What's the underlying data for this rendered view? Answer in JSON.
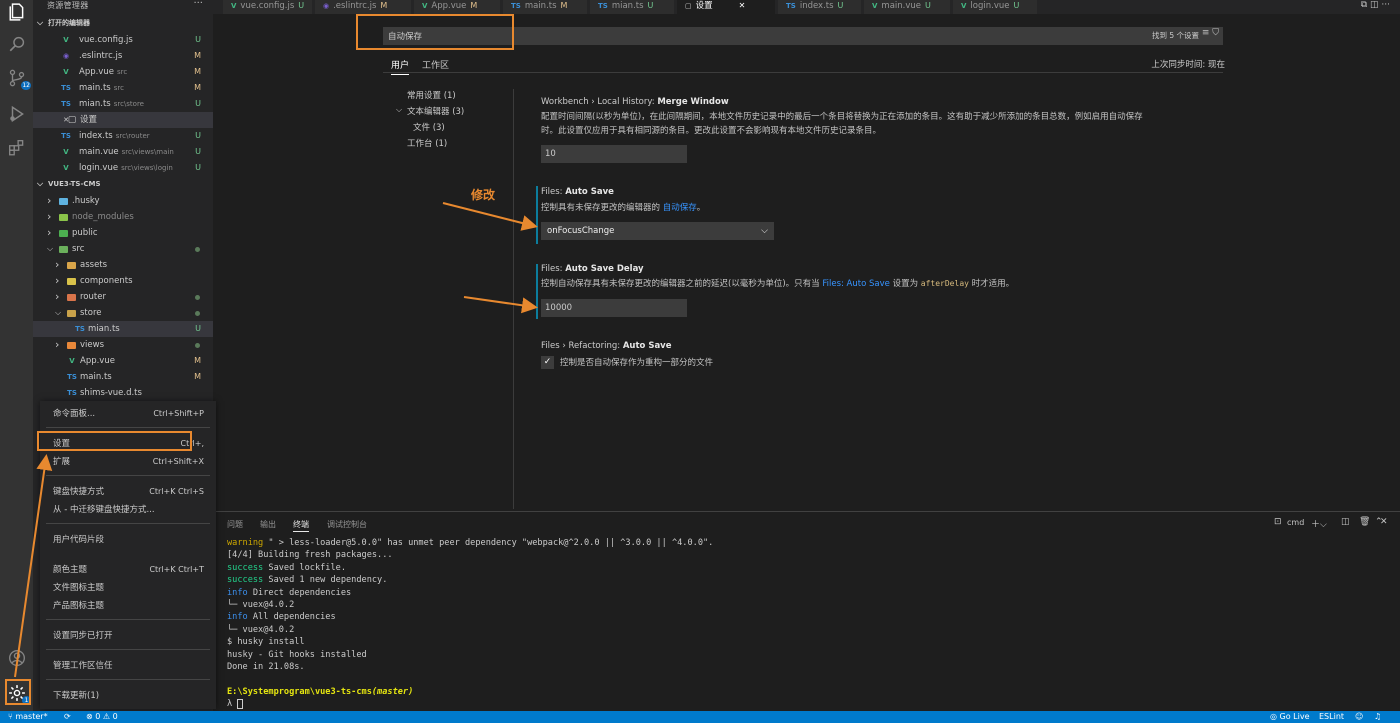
{
  "sidebar": {
    "title": "资源管理器",
    "open_editors_header": "打开的编辑器",
    "open_editors": [
      {
        "icon": "V",
        "name": "vue.config.js",
        "path": "",
        "status": "U"
      },
      {
        "icon": "◉",
        "name": ".eslintrc.js",
        "path": "",
        "status": "M"
      },
      {
        "icon": "V",
        "name": "App.vue",
        "path": "src",
        "status": "M"
      },
      {
        "icon": "TS",
        "name": "main.ts",
        "path": "src",
        "status": "M"
      },
      {
        "icon": "TS",
        "name": "mian.ts",
        "path": "src\\store",
        "status": "U"
      },
      {
        "icon": "✕",
        "name": "设置",
        "path": "",
        "status": ""
      },
      {
        "icon": "TS",
        "name": "index.ts",
        "path": "src\\router",
        "status": "U"
      },
      {
        "icon": "V",
        "name": "main.vue",
        "path": "src\\views\\main",
        "status": "U"
      },
      {
        "icon": "V",
        "name": "login.vue",
        "path": "src\\views\\login",
        "status": "U"
      }
    ],
    "project_header": "VUE3-TS-CMS",
    "tree": [
      {
        "name": ".husky",
        "status": ""
      },
      {
        "name": "node_modules",
        "status": ""
      },
      {
        "name": "public",
        "status": ""
      },
      {
        "name": "src",
        "status": "•"
      },
      {
        "name": "assets",
        "status": ""
      },
      {
        "name": "components",
        "status": ""
      },
      {
        "name": "router",
        "status": "•"
      },
      {
        "name": "store",
        "status": "•"
      },
      {
        "name": "mian.ts",
        "status": "U"
      },
      {
        "name": "views",
        "status": "•"
      },
      {
        "name": "App.vue",
        "status": "M"
      },
      {
        "name": "main.ts",
        "status": "M"
      },
      {
        "name": "shims-vue.d.ts",
        "status": ""
      }
    ]
  },
  "activity": {
    "scm_badge": "12",
    "manage_badge": "1"
  },
  "menu": {
    "items": [
      {
        "label": "命令面板...",
        "key": "Ctrl+Shift+P"
      },
      {
        "label": "设置",
        "key": "Ctrl+,"
      },
      {
        "label": "扩展",
        "key": "Ctrl+Shift+X"
      },
      {
        "label": "键盘快捷方式",
        "key": "Ctrl+K Ctrl+S"
      },
      {
        "label": "从 - 中迁移键盘快捷方式...",
        "key": ""
      },
      {
        "label": "用户代码片段",
        "key": ""
      },
      {
        "label": "颜色主题",
        "key": "Ctrl+K Ctrl+T"
      },
      {
        "label": "文件图标主题",
        "key": ""
      },
      {
        "label": "产品图标主题",
        "key": ""
      },
      {
        "label": "设置同步已打开",
        "key": ""
      },
      {
        "label": "管理工作区信任",
        "key": ""
      },
      {
        "label": "下载更新(1)",
        "key": ""
      }
    ]
  },
  "tabs": [
    {
      "icon": "V",
      "label": "vue.config.js",
      "status": "U",
      "active": false
    },
    {
      "icon": "◉",
      "label": ".eslintrc.js",
      "status": "M",
      "active": false
    },
    {
      "icon": "V",
      "label": "App.vue",
      "status": "M",
      "active": false
    },
    {
      "icon": "TS",
      "label": "main.ts",
      "status": "M",
      "active": false
    },
    {
      "icon": "TS",
      "label": "mian.ts",
      "status": "U",
      "active": false
    },
    {
      "icon": "▢",
      "label": "设置",
      "status": "✕",
      "active": true
    },
    {
      "icon": "TS",
      "label": "index.ts",
      "status": "U",
      "active": false
    },
    {
      "icon": "V",
      "label": "main.vue",
      "status": "U",
      "active": false
    },
    {
      "icon": "V",
      "label": "login.vue",
      "status": "U",
      "active": false
    }
  ],
  "settings": {
    "search_value": "自动保存",
    "found_text": "找到 5 个设置",
    "scope_tabs": [
      "用户",
      "工作区"
    ],
    "sync_text": "上次同步时间: 现在",
    "toc": [
      "常用设置 (1)",
      "文本编辑器 (3)",
      "文件 (3)",
      "工作台 (1)"
    ],
    "items": [
      {
        "category": "Workbench › Local History: ",
        "name": "Merge Window",
        "desc_1": "配置时间间隔(以秒为单位)，在此间隔期间，本地文件历史记录中的最后一个条目将替换为正在添加的条目。这有助于减少所添加的条目总数，例如启用自动保存",
        "desc_2": "时。此设置仅应用于具有相同源的条目。更改此设置不会影响现有本地文件历史记录条目。",
        "value": "10"
      },
      {
        "category": "Files: ",
        "name": "Auto Save",
        "desc_pre": "控制具有未保存更改的编辑器的 ",
        "desc_link": "自动保存",
        "desc_post": "。",
        "value": "onFocusChange"
      },
      {
        "category": "Files: ",
        "name": "Auto Save Delay",
        "desc_pre": "控制自动保存具有未保存更改的编辑器之前的延迟(以毫秒为单位)。只有当 ",
        "desc_link": "Files: Auto Save",
        "desc_mid": " 设置为 ",
        "desc_code": "afterDelay",
        "desc_post": " 时才适用。",
        "value": "10000"
      },
      {
        "category": "Files › Refactoring: ",
        "name": "Auto Save",
        "desc": "控制是否自动保存作为重构一部分的文件",
        "checked": true
      }
    ]
  },
  "annotation": {
    "label": "修改",
    "color": "#e8892f"
  },
  "panel": {
    "tabs": [
      "问题",
      "输出",
      "终端",
      "调试控制台"
    ],
    "active_tab": "终端",
    "shell": "cmd",
    "terminal": {
      "l1_tag": "warning",
      "l1_text": " \" > less-loader@5.0.0\" has unmet peer dependency \"webpack@^2.0.0 || ^3.0.0 || ^4.0.0\".",
      "l2": "[4/4] Building fresh packages...",
      "l3_tag": "success",
      "l3_text": " Saved lockfile.",
      "l4_tag": "success",
      "l4_text": " Saved 1 new dependency.",
      "l5_tag": "info",
      "l5_text": " Direct dependencies",
      "l6": "└─ vuex@4.0.2",
      "l7_tag": "info",
      "l7_text": " All dependencies",
      "l8": "└─ vuex@4.0.2",
      "l9": "$ husky install",
      "l10": "husky - Git hooks installed",
      "l11": "Done in 21.08s.",
      "prompt_path": "E:\\Systemprogram\\vue3-ts-cms",
      "prompt_branch": "(master)",
      "prompt_symbol": "λ"
    }
  },
  "status": {
    "branch": "master*",
    "errors": "0",
    "warnings": "0",
    "golive": "Go Live",
    "eslint": "ESLint"
  },
  "colors": {
    "accent": "#007acc",
    "annotation": "#e8892f",
    "untracked": "#73c991",
    "modified": "#e2c08d"
  }
}
